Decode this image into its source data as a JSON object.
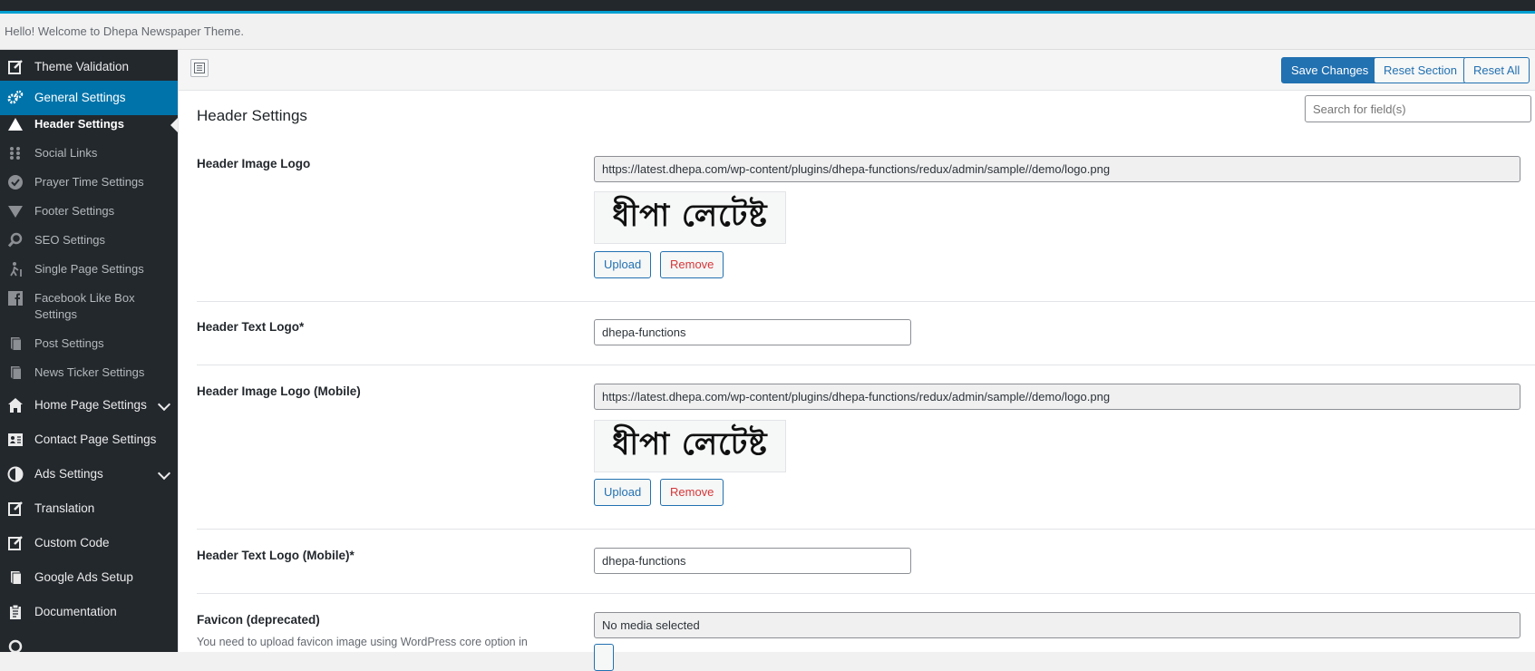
{
  "welcome_text": "Hello! Welcome to Dhepa Newspaper Theme.",
  "sidebar": {
    "items": [
      {
        "label": "Theme Validation",
        "icon": "edit-icon"
      },
      {
        "label": "General Settings",
        "icon": "gears-icon"
      },
      {
        "label": "Header Settings",
        "icon": "triangle-icon"
      },
      {
        "label": "Social Links",
        "icon": "grip-icon"
      },
      {
        "label": "Prayer Time Settings",
        "icon": "check-circle-icon"
      },
      {
        "label": "Footer Settings",
        "icon": "triangle-down-icon"
      },
      {
        "label": "SEO Settings",
        "icon": "search-icon"
      },
      {
        "label": "Single Page Settings",
        "icon": "walker-icon"
      },
      {
        "label": "Facebook Like Box Settings",
        "icon": "facebook-icon"
      },
      {
        "label": "Post Settings",
        "icon": "book-icon"
      },
      {
        "label": "News Ticker Settings",
        "icon": "book-icon"
      },
      {
        "label": "Home Page Settings",
        "icon": "home-icon"
      },
      {
        "label": "Contact Page Settings",
        "icon": "contact-card-icon"
      },
      {
        "label": "Ads Settings",
        "icon": "half-circle-icon"
      },
      {
        "label": "Translation",
        "icon": "edit-icon"
      },
      {
        "label": "Custom Code",
        "icon": "edit-icon"
      },
      {
        "label": "Google Ads Setup",
        "icon": "book-icon"
      },
      {
        "label": "Documentation",
        "icon": "clipboard-icon"
      }
    ]
  },
  "toolbar": {
    "save_label": "Save Changes",
    "reset_section_label": "Reset Section",
    "reset_all_label": "Reset All",
    "search_placeholder": "Search for field(s)"
  },
  "section_title": "Header Settings",
  "fields": {
    "header_image_logo": {
      "label": "Header Image Logo",
      "url": "https://latest.dhepa.com/wp-content/plugins/dhepa-functions/redux/admin/sample//demo/logo.png",
      "logo_text": "ধীপা লেটেষ্ট",
      "upload_label": "Upload",
      "remove_label": "Remove"
    },
    "header_text_logo": {
      "label": "Header Text Logo*",
      "value": "dhepa-functions"
    },
    "header_image_logo_mobile": {
      "label": "Header Image Logo (Mobile)",
      "url": "https://latest.dhepa.com/wp-content/plugins/dhepa-functions/redux/admin/sample//demo/logo.png",
      "logo_text": "ধীপা লেটেষ্ট",
      "upload_label": "Upload",
      "remove_label": "Remove"
    },
    "header_text_logo_mobile": {
      "label": "Header Text Logo (Mobile)*",
      "value": "dhepa-functions"
    },
    "favicon": {
      "label": "Favicon (deprecated)",
      "description": "You need to upload favicon image using WordPress core option in",
      "value": "No media selected"
    }
  },
  "colors": {
    "sidebar_bg": "#23282d",
    "active_bg": "#0073aa",
    "primary": "#2271b1",
    "remove": "#d63638"
  }
}
